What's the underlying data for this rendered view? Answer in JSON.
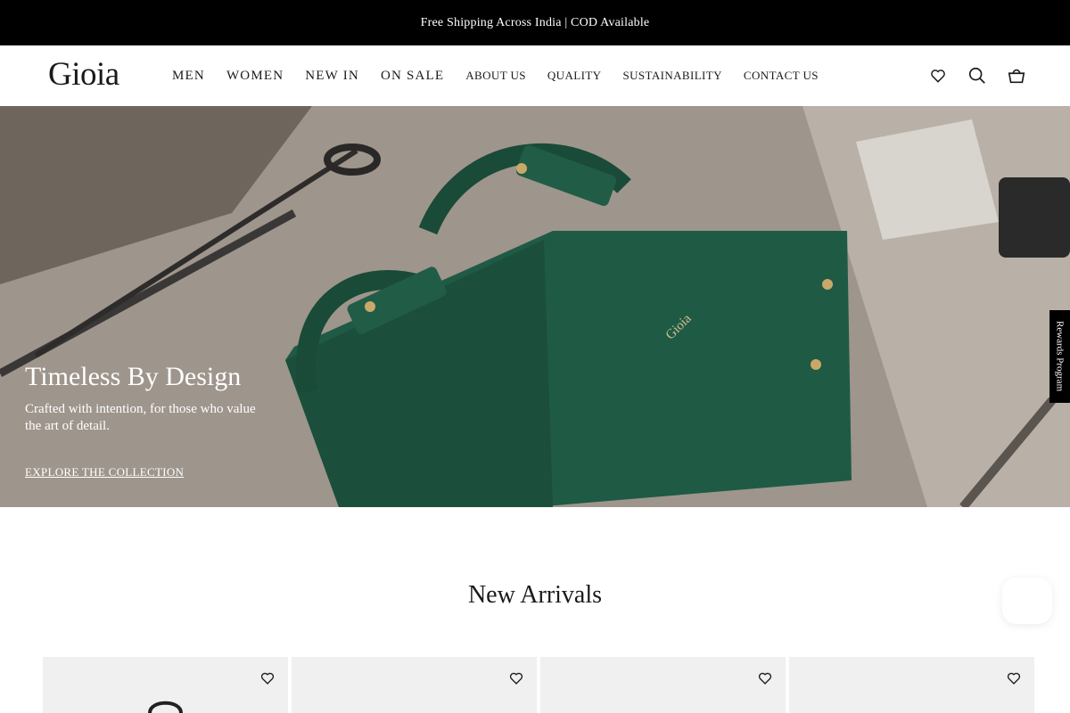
{
  "announcement": "Free Shipping Across India | COD Available",
  "logo": "Gioia",
  "nav": {
    "items": [
      "MEN",
      "WOMEN",
      "NEW IN",
      "ON SALE",
      "ABOUT US",
      "QUALITY",
      "SUSTAINABILITY",
      "CONTACT US"
    ]
  },
  "icons": [
    "heart-icon",
    "search-icon",
    "basket-icon"
  ],
  "hero": {
    "title": "Timeless By Design",
    "subtitle": "Crafted with intention, for those who value the art of detail.",
    "cta": "EXPLORE THE COLLECTION",
    "bag_brand": "Gioia"
  },
  "rewards": "Rewards Program",
  "section": {
    "title": "New Arrivals"
  },
  "products": [
    {
      "wishlist_icon": "heart-icon"
    },
    {
      "wishlist_icon": "heart-icon"
    },
    {
      "wishlist_icon": "heart-icon"
    },
    {
      "wishlist_icon": "heart-icon"
    }
  ],
  "colors": {
    "bag": "#1f5a45",
    "announcement_bg": "#000000"
  }
}
